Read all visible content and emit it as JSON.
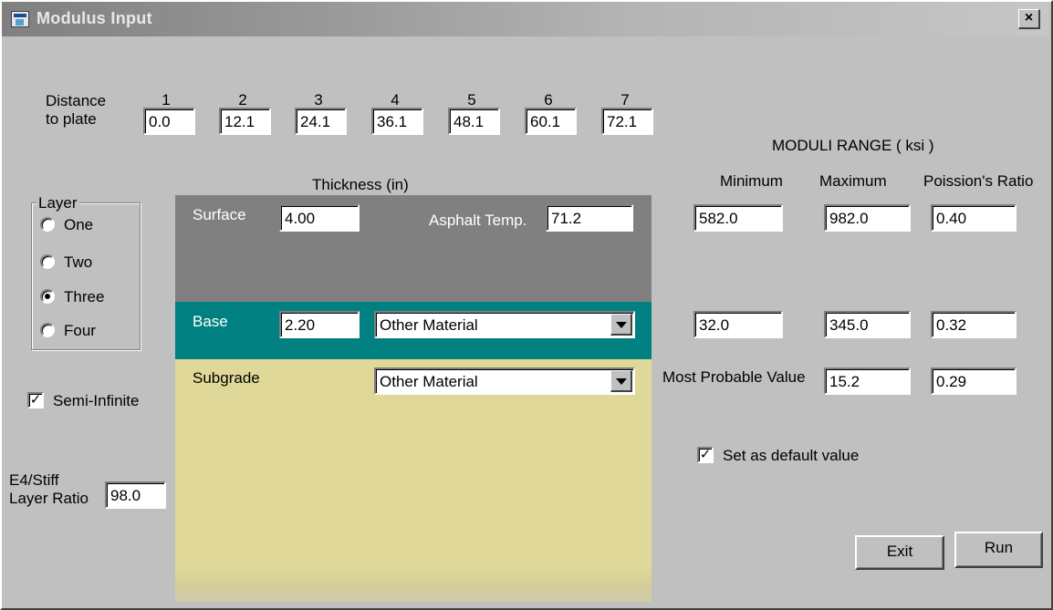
{
  "window": {
    "title": "Modulus Input",
    "close_label": "×"
  },
  "distance": {
    "label_line1": "Distance",
    "label_line2": "to plate",
    "sensors": [
      {
        "number": "1",
        "value": "0.0"
      },
      {
        "number": "2",
        "value": "12.1"
      },
      {
        "number": "3",
        "value": "24.1"
      },
      {
        "number": "4",
        "value": "36.1"
      },
      {
        "number": "5",
        "value": "48.1"
      },
      {
        "number": "6",
        "value": "60.1"
      },
      {
        "number": "7",
        "value": "72.1"
      }
    ]
  },
  "layer_group": {
    "title": "Layer",
    "options": [
      {
        "label": "One",
        "checked": false
      },
      {
        "label": "Two",
        "checked": false
      },
      {
        "label": "Three",
        "checked": true
      },
      {
        "label": "Four",
        "checked": false
      }
    ]
  },
  "semi_infinite": {
    "label": "Semi-Infinite",
    "checked": true
  },
  "stiff_ratio": {
    "label_line1": "E4/Stiff",
    "label_line2": "Layer Ratio",
    "value": "98.0"
  },
  "thickness_header": "Thickness (in)",
  "layers": {
    "surface": {
      "label": "Surface",
      "thickness": "4.00",
      "asphalt_temp_label": "Asphalt Temp.",
      "asphalt_temp": "71.2",
      "color": "#808080"
    },
    "base": {
      "label": "Base",
      "thickness": "2.20",
      "material": "Other Material",
      "color": "#008080"
    },
    "subgrade": {
      "label": "Subgrade",
      "material": "Other Material",
      "color": "#e0d898"
    }
  },
  "moduli": {
    "title": "MODULI RANGE  ( ksi )",
    "headers": {
      "min": "Minimum",
      "max": "Maximum",
      "poisson": "Poission's Ratio"
    },
    "surface": {
      "min": "582.0",
      "max": "982.0",
      "poisson": "0.40"
    },
    "base": {
      "min": "32.0",
      "max": "345.0",
      "poisson": "0.32"
    },
    "subgrade": {
      "most_probable_label": "Most Probable Value",
      "most_probable": "15.2",
      "poisson": "0.29"
    }
  },
  "set_default": {
    "label": "Set as default value",
    "checked": true
  },
  "buttons": {
    "exit": "Exit",
    "run": "Run"
  }
}
